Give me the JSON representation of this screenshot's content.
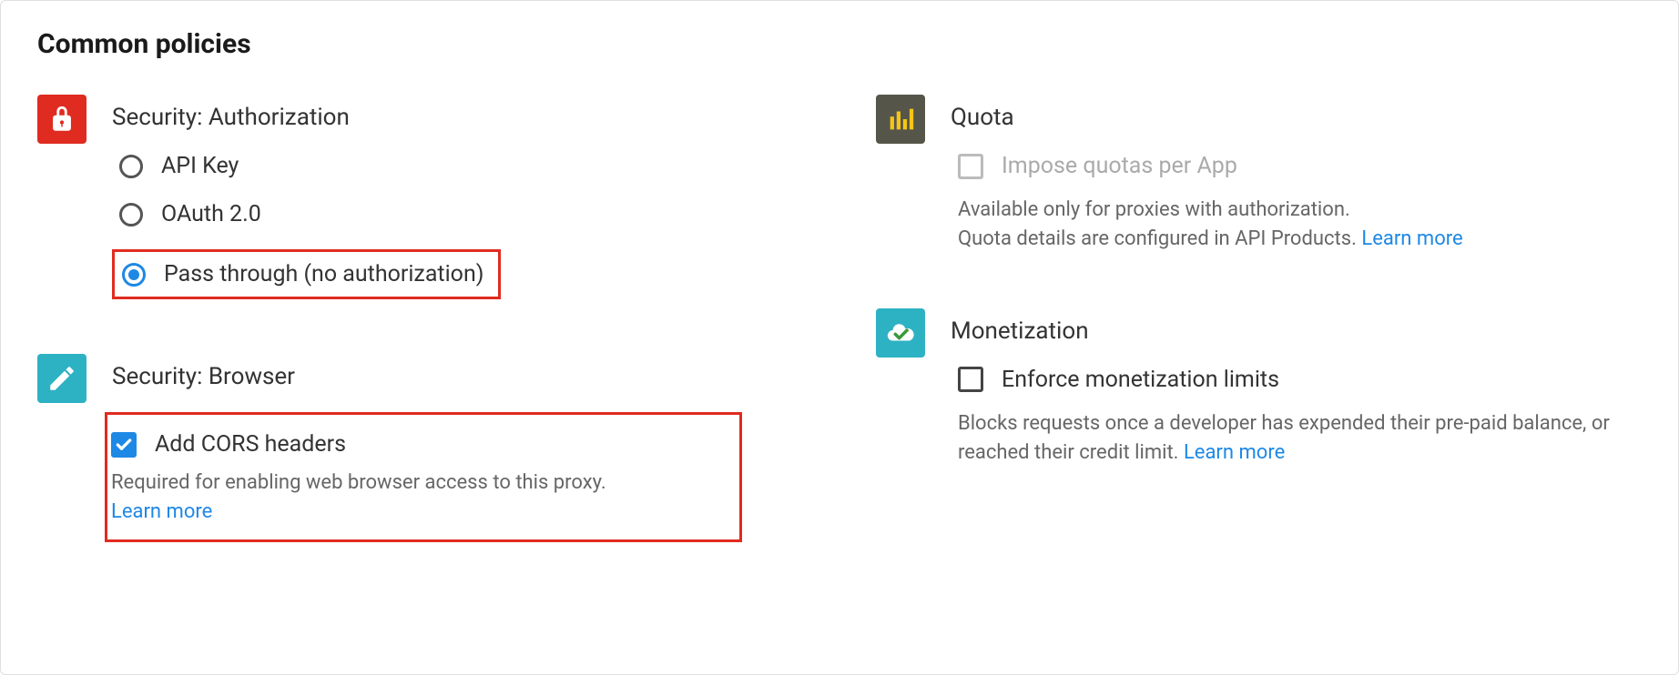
{
  "section_title": "Common policies",
  "security_auth": {
    "title": "Security: Authorization",
    "options": {
      "api_key": "API Key",
      "oauth": "OAuth 2.0",
      "pass_through": "Pass through (no authorization)"
    },
    "selected": "pass_through"
  },
  "security_browser": {
    "title": "Security: Browser",
    "cors_label": "Add CORS headers",
    "cors_checked": true,
    "helper": "Required for enabling web browser access to this proxy.",
    "learn_more": "Learn more"
  },
  "quota": {
    "title": "Quota",
    "impose_label": "Impose quotas per App",
    "impose_checked": false,
    "impose_disabled": true,
    "helper_line1": "Available only for proxies with authorization.",
    "helper_line2": "Quota details are configured in API Products.",
    "learn_more": "Learn more"
  },
  "monetization": {
    "title": "Monetization",
    "enforce_label": "Enforce monetization limits",
    "enforce_checked": false,
    "helper": "Blocks requests once a developer has expended their pre-paid balance, or reached their credit limit.",
    "learn_more": "Learn more"
  }
}
